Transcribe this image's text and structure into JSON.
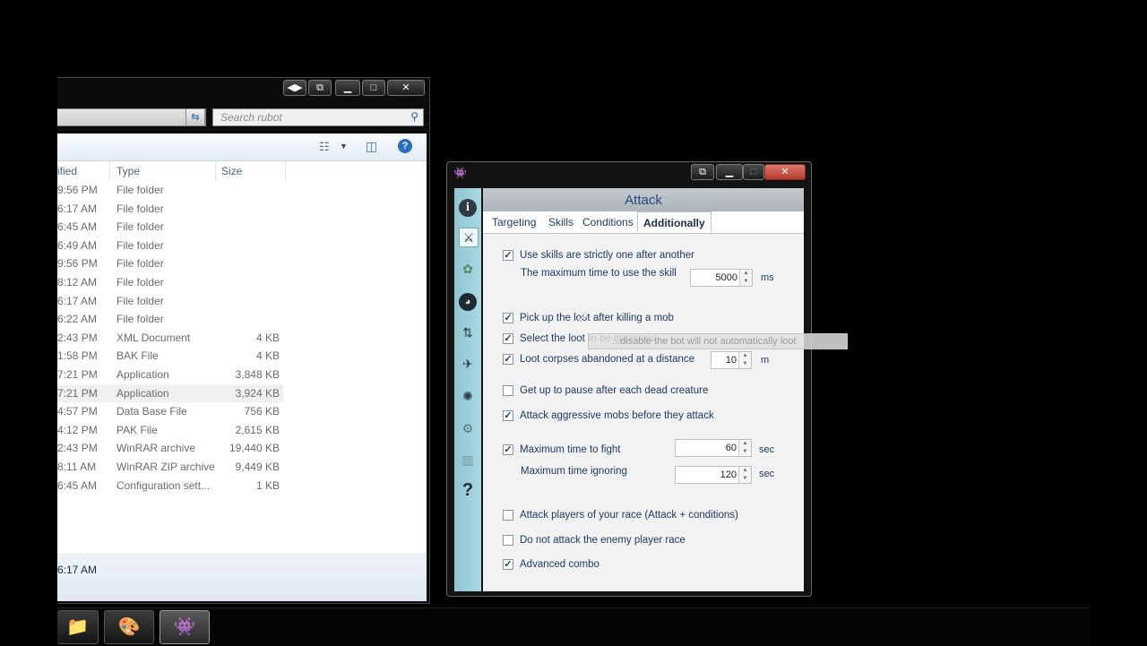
{
  "explorer": {
    "search_placeholder": "Search rubot",
    "columns": {
      "date": "ified",
      "type": "Type",
      "size": "Size"
    },
    "files": [
      {
        "date": "9:56 PM",
        "type": "File folder",
        "size": ""
      },
      {
        "date": "6:17 AM",
        "type": "File folder",
        "size": ""
      },
      {
        "date": "6:45 AM",
        "type": "File folder",
        "size": ""
      },
      {
        "date": "6:49 AM",
        "type": "File folder",
        "size": ""
      },
      {
        "date": "9:56 PM",
        "type": "File folder",
        "size": ""
      },
      {
        "date": "8:12 AM",
        "type": "File folder",
        "size": ""
      },
      {
        "date": "6:17 AM",
        "type": "File folder",
        "size": ""
      },
      {
        "date": "6:22 AM",
        "type": "File folder",
        "size": ""
      },
      {
        "date": "2:43 PM",
        "type": "XML Document",
        "size": "4 KB"
      },
      {
        "date": "1:58 PM",
        "type": "BAK File",
        "size": "4 KB"
      },
      {
        "date": "7:21 PM",
        "type": "Application",
        "size": "3,848 KB"
      },
      {
        "date": "7:21 PM",
        "type": "Application",
        "size": "3,924 KB"
      },
      {
        "date": "4:57 PM",
        "type": "Data Base File",
        "size": "756 KB"
      },
      {
        "date": "4:12 PM",
        "type": "PAK File",
        "size": "2,615 KB"
      },
      {
        "date": "2:43 PM",
        "type": "WinRAR archive",
        "size": "19,440 KB"
      },
      {
        "date": "8:11 AM",
        "type": "WinRAR ZIP archive",
        "size": "9,449 KB"
      },
      {
        "date": "6:45 AM",
        "type": "Configuration sett...",
        "size": "1 KB"
      }
    ],
    "status_time": "6:17 AM"
  },
  "bot": {
    "title": "Attack",
    "tabs": [
      "Targeting",
      "Skills",
      "Conditions",
      "Additionally"
    ],
    "active_tab": "Additionally",
    "options": {
      "strict_skills": {
        "label": "Use skills are strictly one after another",
        "checked": true
      },
      "max_skill_time_label": "The maximum time to use the skill",
      "max_skill_time_value": "5000",
      "max_skill_time_unit": "ms",
      "pickup_loot": {
        "label": "Pick up the loot after killing a mob",
        "checked": true
      },
      "select_loot": {
        "label": "Select the loot to be approved",
        "checked": true
      },
      "loot_corpses": {
        "label": "Loot corpses abandoned at a distance",
        "checked": true
      },
      "loot_distance_value": "10",
      "loot_distance_unit": "m",
      "pause_dead": {
        "label": "Get up to pause after each dead creature",
        "checked": false
      },
      "attack_aggressive": {
        "label": "Attack aggressive mobs before they attack",
        "checked": true
      },
      "max_fight_time": {
        "label": "Maximum time to fight",
        "checked": true
      },
      "max_fight_value": "60",
      "max_fight_unit": "sec",
      "max_ignore_label": "Maximum time ignoring",
      "max_ignore_value": "120",
      "max_ignore_unit": "sec",
      "attack_players_race": {
        "label": "Attack players of your race (Attack + conditions)",
        "checked": false
      },
      "no_attack_enemy_race": {
        "label": "Do not attack the enemy player race",
        "checked": false
      },
      "advanced_combo": {
        "label": "Advanced combo",
        "checked": true
      }
    },
    "tooltip": "...disable the bot will not automatically loot",
    "check_glyph": "✓"
  }
}
